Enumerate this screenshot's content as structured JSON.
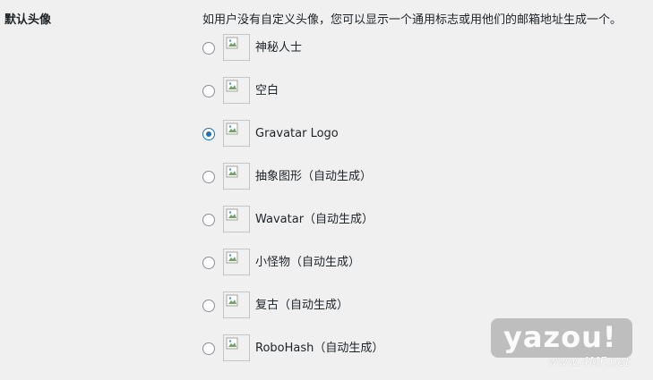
{
  "section": {
    "label": "默认头像",
    "description": "如用户没有自定义头像，您可以显示一个通用标志或用他们的邮箱地址生成一个。"
  },
  "options": [
    {
      "label": "神秘人士",
      "checked": false
    },
    {
      "label": "空白",
      "checked": false
    },
    {
      "label": "Gravatar Logo",
      "checked": true
    },
    {
      "label": "抽象图形（自动生成）",
      "checked": false
    },
    {
      "label": "Wavatar（自动生成）",
      "checked": false
    },
    {
      "label": "小怪物（自动生成）",
      "checked": false
    },
    {
      "label": "复古（自动生成）",
      "checked": false
    },
    {
      "label": "RoboHash（自动生成）",
      "checked": false
    }
  ],
  "watermark": {
    "text": "yazou!",
    "sub": "www.4MF.net"
  },
  "colors": {
    "accent": "#2271b1",
    "background": "#f0f0f1",
    "text": "#1d2327"
  }
}
